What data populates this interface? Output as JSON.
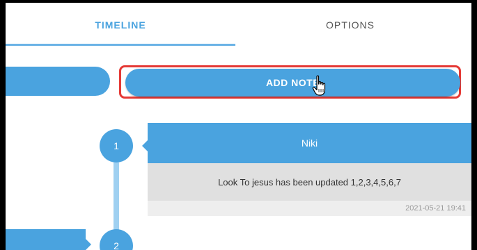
{
  "tabs": [
    {
      "label": "TIMELINE",
      "active": true
    },
    {
      "label": "OPTIONS",
      "active": false
    }
  ],
  "actions": {
    "add_note_label": "ADD NOTE"
  },
  "timeline": {
    "entries": [
      {
        "index": "1",
        "author": "Niki",
        "message": "Look To jesus has been updated 1,2,3,4,5,6,7",
        "timestamp": "2021-05-21 19:41"
      },
      {
        "index": "2"
      }
    ]
  },
  "colors": {
    "accent": "#4aa3df",
    "highlight_border": "#e53935",
    "card_body": "#e0e0e0"
  },
  "icons": {
    "cursor": "hand-pointer-icon"
  }
}
